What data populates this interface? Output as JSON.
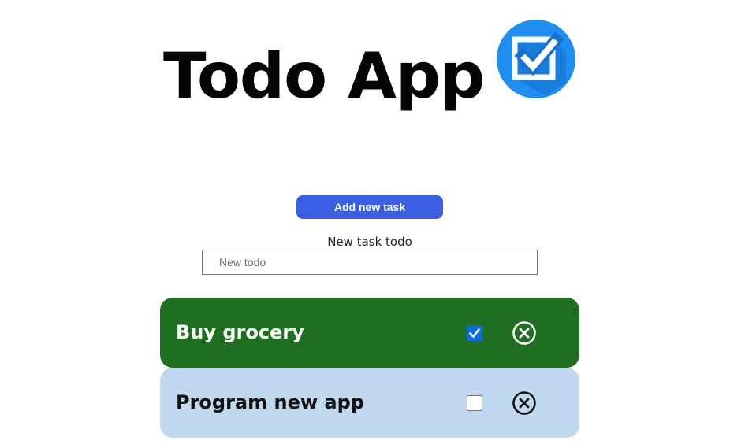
{
  "header": {
    "title": "Todo App",
    "logo_icon": "checkbox-logo-icon"
  },
  "form": {
    "add_button_label": "Add new task",
    "field_label": "New task todo",
    "input_placeholder": "New todo",
    "input_value": ""
  },
  "todos": [
    {
      "text": "Buy grocery",
      "completed": true,
      "remove_icon": "close-circle-icon"
    },
    {
      "text": "Program new app",
      "completed": false,
      "remove_icon": "close-circle-icon"
    }
  ],
  "colors": {
    "button": "#3a5fe5",
    "done_card": "#1f6e22",
    "pending_card": "#c1d9ef",
    "logo_blue": "#1e8ef0",
    "checkbox_checked": "#0b6ce6"
  }
}
